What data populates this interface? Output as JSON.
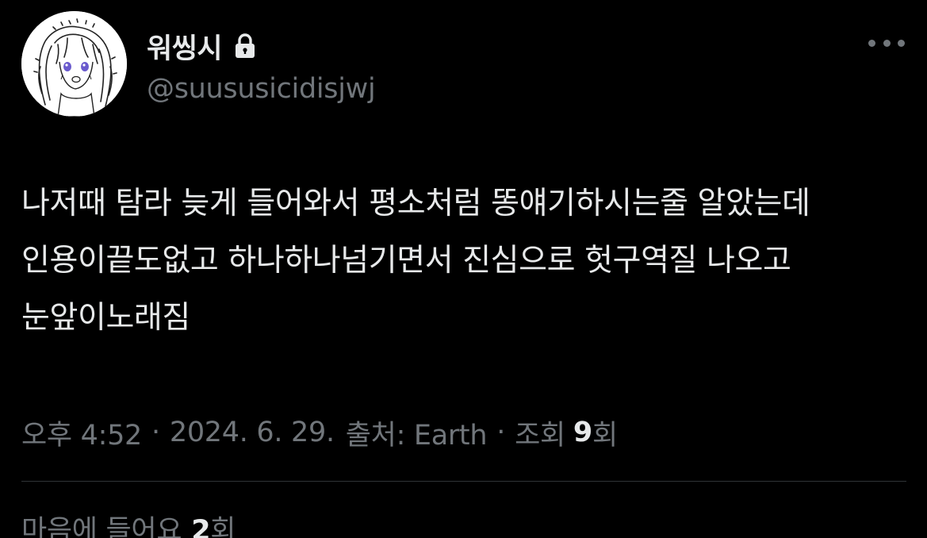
{
  "author": {
    "display_name": "워씽시",
    "handle": "@suususicidisjwj",
    "protected_icon": "lock-icon",
    "avatar_icon": "drawn-character-avatar"
  },
  "menu": {
    "more_icon": "more-horizontal-icon"
  },
  "tweet": {
    "text": "나저때 탐라 늦게 들어와서 평소처럼 똥얘기하시는줄 알았는데 인용이끝도없고 하나하나넘기면서 진심으로 헛구역질 나오고 눈앞이노래짐"
  },
  "meta": {
    "time": "오후 4:52",
    "date": "2024. 6. 29.",
    "source_label": "출처: Earth",
    "views_label": "조회",
    "views_count": "9",
    "views_suffix": "회",
    "separator": "·"
  },
  "engagement": {
    "likes_label": "마음에 들어요",
    "likes_count": "2",
    "likes_suffix": "회"
  },
  "colors": {
    "background": "#000000",
    "primary_text": "#e7e9ea",
    "secondary_text": "#71767b",
    "divider": "#2f3336"
  }
}
